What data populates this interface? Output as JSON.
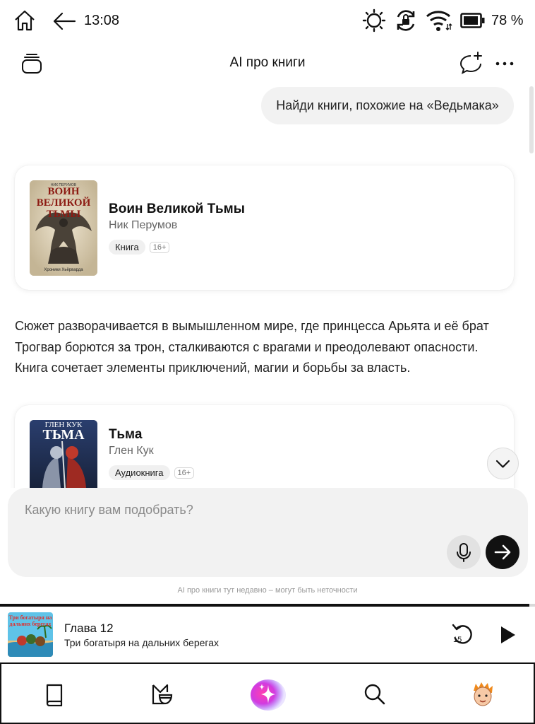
{
  "status_bar": {
    "time": "13:08",
    "battery_percent": "78 %"
  },
  "header": {
    "title": "AI про книги"
  },
  "chat": {
    "user_message": "Найди книги, похожие на «Ведьмака»",
    "description": "Сюжет разворачивается в вымышленном мире, где принцесса Арьята и её брат Трогвар борются за трон, сталкиваются с врагами и преодолевают опасности. Книга сочетает элементы приключений, магии и борьбы за власть.",
    "books": [
      {
        "cover_top_text": "НИК ПЕРУМОВ",
        "cover_title_lines": [
          "ВОИН",
          "ВЕЛИКОЙ",
          "ТЬМЫ"
        ],
        "cover_bottom_text": "Хроники Хьёрварда",
        "title": "Воин Великой Тьмы",
        "author": "Ник Перумов",
        "format": "Книга",
        "age_rating": "16+"
      },
      {
        "cover_top_text": "ГЛЕН КУК",
        "cover_title_lines": [
          "ТЬМА"
        ],
        "title": "Тьма",
        "author": "Глен Кук",
        "format": "Аудиокнига",
        "age_rating": "16+"
      }
    ]
  },
  "input": {
    "placeholder": "Какую книгу вам подобрать?",
    "disclaimer": "AI про книги тут недавно – могут быть неточности"
  },
  "player": {
    "cover_text": "Три богатыря на дальних берегах",
    "chapter": "Глава 12",
    "book_title": "Три богатыря на дальних берегах",
    "rewind_seconds": "15",
    "progress_fraction": 0.99
  },
  "bottom_nav": {
    "items": [
      "library-icon",
      "bookmate-icon",
      "ai-assistant-icon",
      "search-icon",
      "profile-avatar"
    ]
  },
  "colors": {
    "accent_gradient_start": "#ff3fb0",
    "accent_gradient_end": "#7b4dff",
    "text_primary": "#111111",
    "text_secondary": "#666666"
  }
}
